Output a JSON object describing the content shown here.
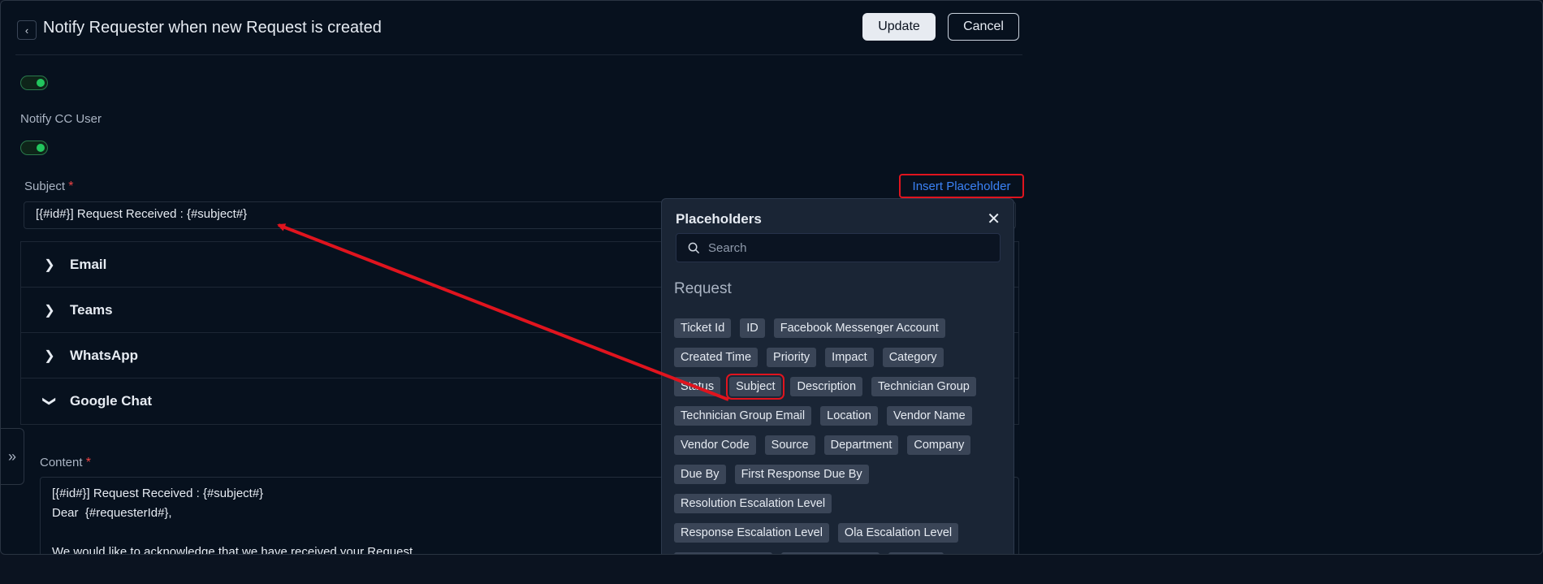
{
  "header": {
    "title": "Notify Requester when new Request is created",
    "back_icon": "‹",
    "update_label": "Update",
    "cancel_label": "Cancel"
  },
  "toggles": {
    "first_enabled": true,
    "notify_cc_label": "Notify CC User",
    "notify_cc_enabled": true
  },
  "subject": {
    "label": "Subject",
    "required_mark": "*",
    "value": "[{#id#}] Request Received : {#subject#}",
    "insert_placeholder_label": "Insert Placeholder"
  },
  "channels": [
    {
      "label": "Email",
      "expanded": false
    },
    {
      "label": "Teams",
      "expanded": false
    },
    {
      "label": "WhatsApp",
      "expanded": false
    },
    {
      "label": "Google Chat",
      "expanded": true
    }
  ],
  "content": {
    "label": "Content",
    "required_mark": "*",
    "lines": [
      "[{#id#}] Request Received : {#subject#}",
      "Dear  {#requesterId#},",
      "",
      "We would like to acknowledge that we have received your Request."
    ]
  },
  "side_toggle_icon": "»",
  "placeholders_popup": {
    "title": "Placeholders",
    "close_icon": "✕",
    "search_placeholder": "Search",
    "section": "Request",
    "chip_rows": [
      [
        "Ticket Id",
        "ID",
        "Facebook Messenger Account"
      ],
      [
        "Created Time",
        "Priority",
        "Impact",
        "Category"
      ],
      [
        "Status",
        "Subject",
        "Description",
        "Technician Group"
      ],
      [
        "Technician Group Email",
        "Location",
        "Vendor Name"
      ],
      [
        "Vendor Code",
        "Source",
        "Department",
        "Company"
      ],
      [
        "Due By",
        "First Response Due By"
      ],
      [
        "Resolution Escalation Level"
      ],
      [
        "Response Escalation Level",
        "Ola Escalation Level"
      ]
    ],
    "highlighted_chip": "Subject"
  },
  "colors": {
    "background": "#07111e",
    "accent_blue": "#3b82f6",
    "annotation_red": "#e0141e",
    "toggle_green": "#22c55e",
    "required_red": "#ef4444"
  }
}
